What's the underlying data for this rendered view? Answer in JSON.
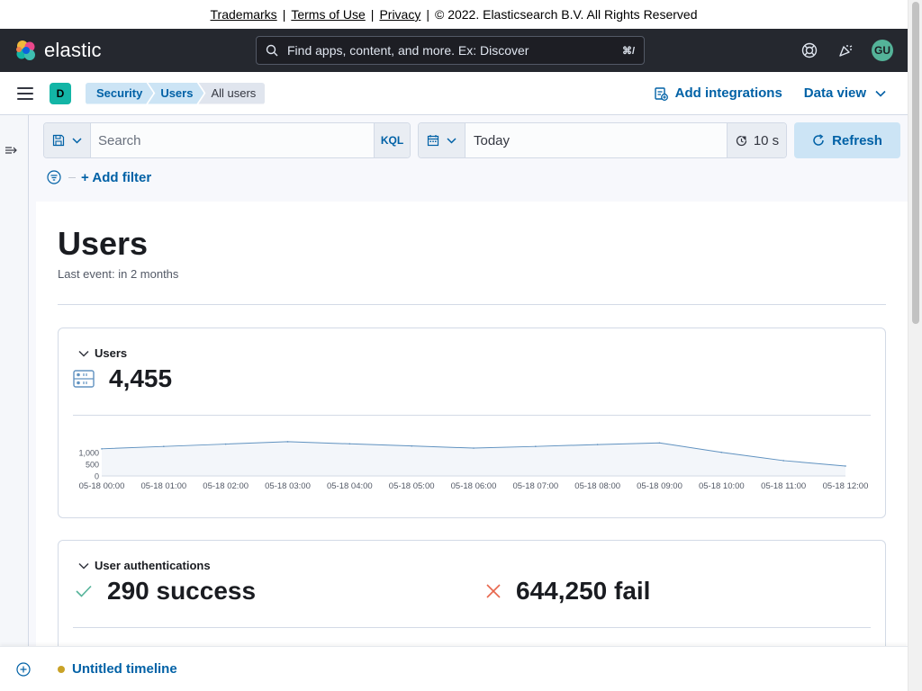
{
  "legal": {
    "trademarks": "Trademarks",
    "sep1": "|",
    "terms": "Terms of Use",
    "sep2": "|",
    "privacy": "Privacy",
    "sep3": "|",
    "copyright": "© 2022. Elasticsearch B.V. All Rights Reserved"
  },
  "header": {
    "brand": "elastic",
    "search_placeholder": "Find apps, content, and more. Ex: Discover",
    "search_shortcut": "⌘/",
    "avatar_initials": "GU",
    "icons": [
      "help-icon",
      "newsfeed-icon"
    ]
  },
  "subheader": {
    "space_initial": "D",
    "breadcrumbs": [
      "Security",
      "Users",
      "All users"
    ],
    "add_integrations": "Add integrations",
    "data_view": "Data view"
  },
  "querybar": {
    "search_placeholder": "Search",
    "language": "KQL",
    "date": "Today",
    "refresh_interval": "10 s",
    "refresh_label": "Refresh",
    "add_filter": "+ Add filter"
  },
  "page": {
    "title": "Users",
    "last_event": "Last event: in 2 months"
  },
  "users_panel": {
    "title": "Users",
    "total": "4,455"
  },
  "chart_data": {
    "type": "area",
    "title": "",
    "xlabel": "",
    "ylabel": "",
    "x": [
      "05-18 00:00",
      "05-18 01:00",
      "05-18 02:00",
      "05-18 03:00",
      "05-18 04:00",
      "05-18 05:00",
      "05-18 06:00",
      "05-18 07:00",
      "05-18 08:00",
      "05-18 09:00",
      "05-18 10:00",
      "05-18 11:00",
      "05-18 12:00"
    ],
    "y_ticks": [
      "0",
      "500",
      "1,000"
    ],
    "ylim": [
      0,
      1600
    ],
    "series": [
      {
        "values": [
          1150,
          1250,
          1350,
          1450,
          1360,
          1270,
          1180,
          1250,
          1330,
          1400,
          1000,
          650,
          420
        ]
      }
    ],
    "color": "#6092c0",
    "fill": "#f3f6fa"
  },
  "auth_panel": {
    "title": "User authentications",
    "success": "290 success",
    "fail": "644,250 fail",
    "success_color": "#54b399",
    "fail_color": "#e7664c"
  },
  "timeline": {
    "name": "Untitled timeline"
  }
}
